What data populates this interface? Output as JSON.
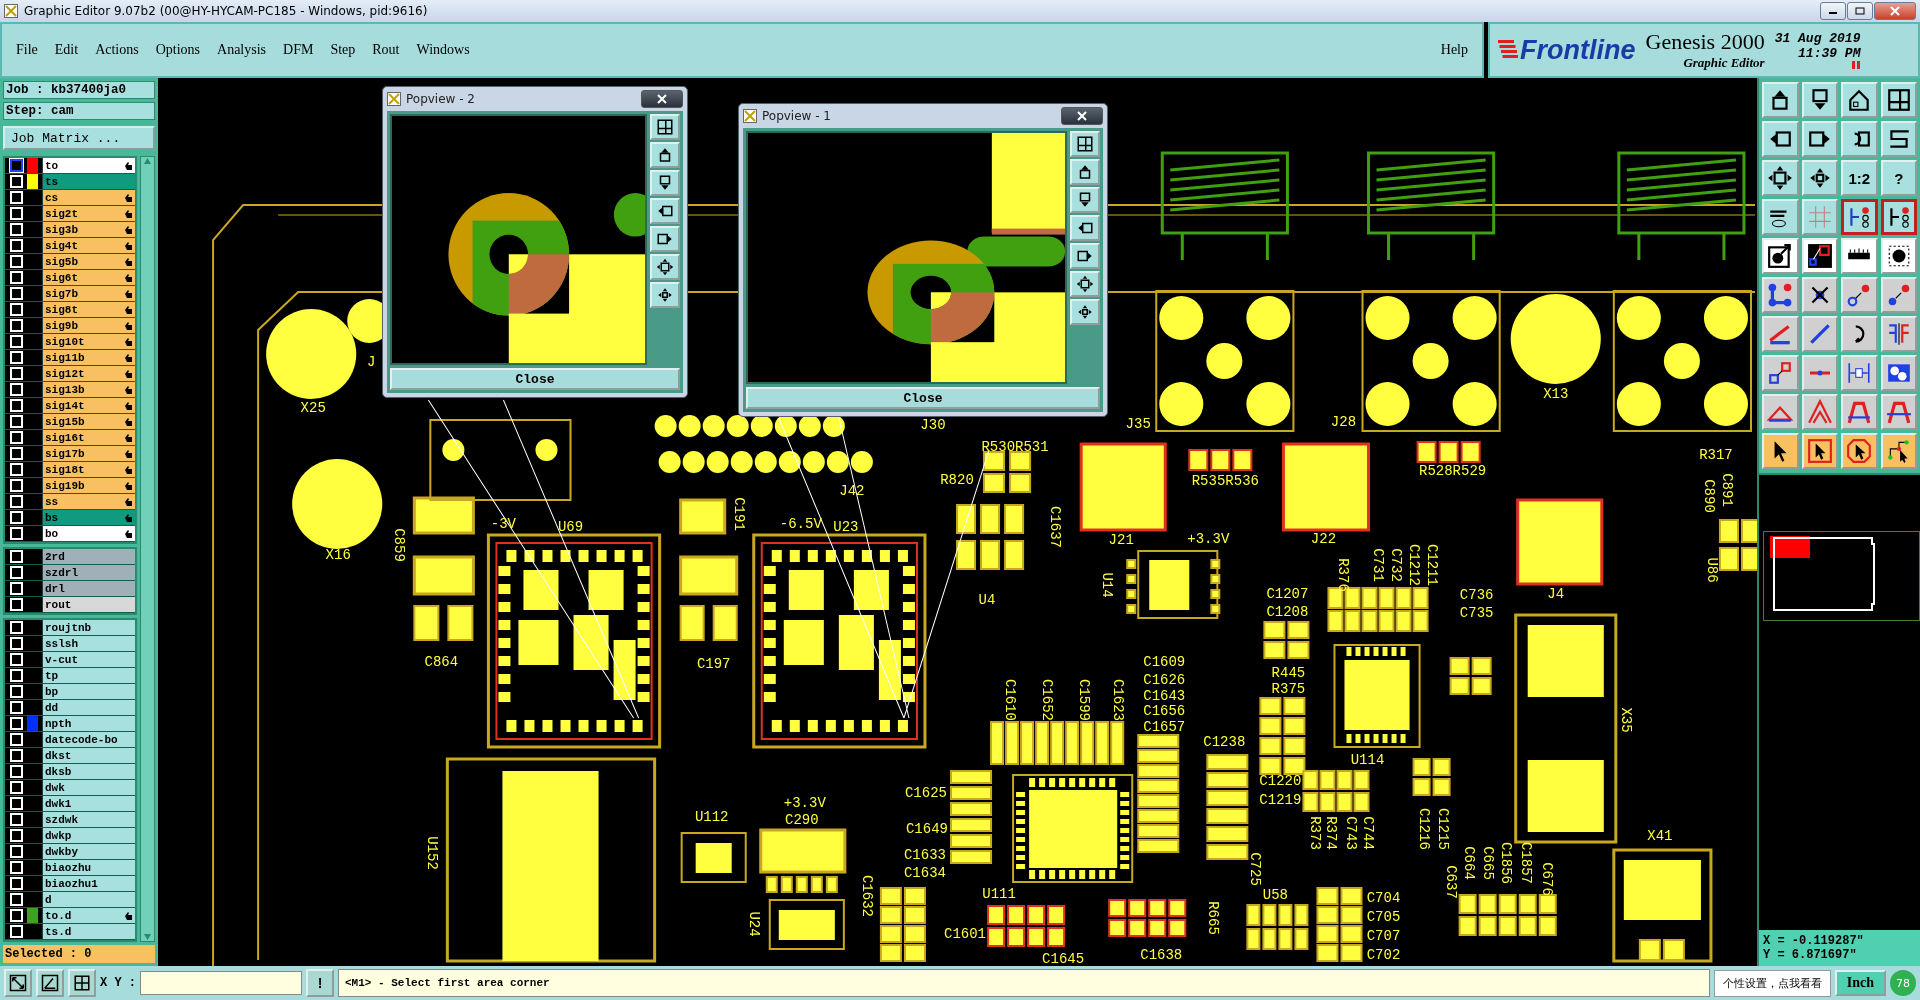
{
  "window": {
    "title": "Graphic Editor 9.07b2 (00@HY-HYCAM-PC185 - Windows, pid:9616)"
  },
  "menu": [
    "File",
    "Edit",
    "Actions",
    "Options",
    "Analysis",
    "DFM",
    "Step",
    "Rout",
    "Windows"
  ],
  "help": "Help",
  "brand": {
    "logo": "Frontline",
    "product": "Genesis 2000",
    "subtitle": "Graphic Editor",
    "date": "31 Aug 2019",
    "time": "11:39 PM"
  },
  "job": {
    "job": "Job : kb37400ja0",
    "step": "Step: cam",
    "matrix_button": "Job Matrix ..."
  },
  "layer_groups": [
    {
      "layers": [
        {
          "name": "to",
          "kind": "silk",
          "color": "#ff0000",
          "work": true,
          "board": true
        },
        {
          "name": "ts",
          "kind": "mask",
          "color": "#ffff00",
          "work": false,
          "board": false
        },
        {
          "name": "cs",
          "kind": "signal",
          "work": false,
          "board": true
        },
        {
          "name": "sig2t",
          "kind": "signal",
          "work": false,
          "board": true
        },
        {
          "name": "sig3b",
          "kind": "signal",
          "work": false,
          "board": true
        },
        {
          "name": "sig4t",
          "kind": "signal",
          "work": false,
          "board": true
        },
        {
          "name": "sig5b",
          "kind": "signal",
          "work": false,
          "board": true
        },
        {
          "name": "sig6t",
          "kind": "signal",
          "work": false,
          "board": true
        },
        {
          "name": "sig7b",
          "kind": "signal",
          "work": false,
          "board": true
        },
        {
          "name": "sig8t",
          "kind": "signal",
          "work": false,
          "board": true
        },
        {
          "name": "sig9b",
          "kind": "signal",
          "work": false,
          "board": true
        },
        {
          "name": "sig10t",
          "kind": "signal",
          "work": false,
          "board": true
        },
        {
          "name": "sig11b",
          "kind": "signal",
          "work": false,
          "board": true
        },
        {
          "name": "sig12t",
          "kind": "signal",
          "work": false,
          "board": true
        },
        {
          "name": "sig13b",
          "kind": "signal",
          "work": false,
          "board": true
        },
        {
          "name": "sig14t",
          "kind": "signal",
          "work": false,
          "board": true
        },
        {
          "name": "sig15b",
          "kind": "signal",
          "work": false,
          "board": true
        },
        {
          "name": "sig16t",
          "kind": "signal",
          "work": false,
          "board": true
        },
        {
          "name": "sig17b",
          "kind": "signal",
          "work": false,
          "board": true
        },
        {
          "name": "sig18t",
          "kind": "signal",
          "work": false,
          "board": true
        },
        {
          "name": "sig19b",
          "kind": "signal",
          "work": false,
          "board": true
        },
        {
          "name": "ss",
          "kind": "signal",
          "work": false,
          "board": true
        },
        {
          "name": "bs",
          "kind": "mask",
          "work": false,
          "board": true
        },
        {
          "name": "bo",
          "kind": "silk",
          "work": false,
          "board": true
        }
      ]
    },
    {
      "layers": [
        {
          "name": "2rd",
          "kind": "drill",
          "work": false,
          "board": false
        },
        {
          "name": "szdrl",
          "kind": "drill",
          "work": false,
          "board": false
        },
        {
          "name": "drl",
          "kind": "drill",
          "work": false,
          "board": false
        },
        {
          "name": "rout",
          "kind": "rout",
          "work": false,
          "board": false
        }
      ]
    },
    {
      "layers": [
        {
          "name": "roujtnb",
          "kind": "doc",
          "work": false,
          "board": false
        },
        {
          "name": "sslsh",
          "kind": "doc",
          "work": false,
          "board": false
        },
        {
          "name": "v-cut",
          "kind": "doc",
          "work": false,
          "board": false
        },
        {
          "name": "tp",
          "kind": "doc",
          "work": false,
          "board": false
        },
        {
          "name": "bp",
          "kind": "doc",
          "work": false,
          "board": false
        },
        {
          "name": "dd",
          "kind": "doc",
          "work": false,
          "board": false
        },
        {
          "name": "npth",
          "kind": "doc",
          "color": "#0030ff",
          "work": false,
          "board": false
        },
        {
          "name": "datecode-bo",
          "kind": "doc",
          "work": false,
          "board": false
        },
        {
          "name": "dkst",
          "kind": "doc",
          "work": false,
          "board": false
        },
        {
          "name": "dksb",
          "kind": "doc",
          "work": false,
          "board": false
        },
        {
          "name": "dwk",
          "kind": "doc",
          "work": false,
          "board": false
        },
        {
          "name": "dwk1",
          "kind": "doc",
          "work": false,
          "board": false
        },
        {
          "name": "szdwk",
          "kind": "doc",
          "work": false,
          "board": false
        },
        {
          "name": "dwkp",
          "kind": "doc",
          "work": false,
          "board": false
        },
        {
          "name": "dwkby",
          "kind": "doc",
          "work": false,
          "board": false
        },
        {
          "name": "biaozhu",
          "kind": "doc",
          "work": false,
          "board": false
        },
        {
          "name": "biaozhu1",
          "kind": "doc",
          "work": false,
          "board": false
        },
        {
          "name": "d",
          "kind": "doc",
          "work": false,
          "board": false
        },
        {
          "name": "to.d",
          "kind": "doc",
          "color": "#40a020",
          "work": false,
          "board": true
        },
        {
          "name": "ts.d",
          "kind": "doc",
          "work": false,
          "board": false
        }
      ]
    }
  ],
  "selected": "Selected : 0",
  "toolbar": [
    {
      "kind": "view",
      "on": false
    },
    {
      "kind": "view",
      "on": false
    },
    {
      "kind": "view",
      "on": false
    },
    {
      "kind": "view",
      "on": false
    },
    {
      "kind": "view",
      "on": false
    },
    {
      "kind": "view",
      "on": false
    },
    {
      "kind": "view",
      "on": false
    },
    {
      "kind": "view",
      "on": false
    },
    {
      "kind": "view",
      "on": false
    },
    {
      "kind": "view",
      "on": false
    },
    {
      "kind": "view",
      "on": false,
      "label": "1:2"
    },
    {
      "kind": "view",
      "on": false,
      "label": "?"
    },
    {
      "kind": "view",
      "on": false
    },
    {
      "kind": "view",
      "on": false
    },
    {
      "kind": "view",
      "on": true
    },
    {
      "kind": "view",
      "on": true
    },
    {
      "kind": "measure",
      "on": false
    },
    {
      "kind": "measure",
      "on": false
    },
    {
      "kind": "measure",
      "on": false
    },
    {
      "kind": "measure",
      "on": false
    },
    {
      "kind": "edit",
      "on": false
    },
    {
      "kind": "edit",
      "on": false
    },
    {
      "kind": "edit",
      "on": false
    },
    {
      "kind": "edit",
      "on": false
    },
    {
      "kind": "edit",
      "on": false
    },
    {
      "kind": "edit",
      "on": false
    },
    {
      "kind": "edit",
      "on": false
    },
    {
      "kind": "edit",
      "on": false
    },
    {
      "kind": "edit",
      "on": false
    },
    {
      "kind": "edit",
      "on": false
    },
    {
      "kind": "edit",
      "on": false
    },
    {
      "kind": "edit",
      "on": false
    },
    {
      "kind": "edit",
      "on": false
    },
    {
      "kind": "edit",
      "on": false
    },
    {
      "kind": "edit",
      "on": false
    },
    {
      "kind": "edit",
      "on": false
    },
    {
      "kind": "select",
      "on": false
    },
    {
      "kind": "select",
      "on": false
    },
    {
      "kind": "select",
      "on": false
    },
    {
      "kind": "select",
      "on": false
    }
  ],
  "coordinates": {
    "x": "X = -0.119287\"",
    "y": "Y = 6.871697\""
  },
  "popviews": [
    {
      "title": "Popview - 2",
      "close": "Close"
    },
    {
      "title": "Popview - 1",
      "close": "Close"
    }
  ],
  "canvas_labels": [
    {
      "text": "X25",
      "kind": "horizontal"
    },
    {
      "text": "X16",
      "kind": "horizontal"
    },
    {
      "text": "J",
      "kind": "horizontal"
    },
    {
      "text": "-3V",
      "kind": "horizontal"
    },
    {
      "text": "U69",
      "kind": "horizontal"
    },
    {
      "text": "C864",
      "kind": "horizontal"
    },
    {
      "text": "-6.5V",
      "kind": "horizontal"
    },
    {
      "text": "U23",
      "kind": "horizontal"
    },
    {
      "text": "C197",
      "kind": "horizontal"
    },
    {
      "text": "J42",
      "kind": "horizontal"
    },
    {
      "text": "J30",
      "kind": "horizontal"
    },
    {
      "text": "R530R531",
      "kind": "horizontal"
    },
    {
      "text": "R820",
      "kind": "horizontal"
    },
    {
      "text": "U4",
      "kind": "horizontal"
    },
    {
      "text": "J35",
      "kind": "horizontal"
    },
    {
      "text": "J28",
      "kind": "horizontal"
    },
    {
      "text": "X13",
      "kind": "horizontal"
    },
    {
      "text": "R535R536",
      "kind": "horizontal"
    },
    {
      "text": "R528R529",
      "kind": "horizontal"
    },
    {
      "text": "R317",
      "kind": "horizontal"
    },
    {
      "text": "J21",
      "kind": "horizontal"
    },
    {
      "text": "+3.3V",
      "kind": "horizontal"
    },
    {
      "text": "J22",
      "kind": "horizontal"
    },
    {
      "text": "C1207",
      "kind": "horizontal"
    },
    {
      "text": "C1208",
      "kind": "horizontal"
    },
    {
      "text": "C736",
      "kind": "horizontal"
    },
    {
      "text": "C735",
      "kind": "horizontal"
    },
    {
      "text": "J4",
      "kind": "horizontal"
    },
    {
      "text": "R445",
      "kind": "horizontal"
    },
    {
      "text": "R375",
      "kind": "horizontal"
    },
    {
      "text": "U114",
      "kind": "horizontal"
    },
    {
      "text": "C1609",
      "kind": "horizontal"
    },
    {
      "text": "C1626",
      "kind": "horizontal"
    },
    {
      "text": "C1643",
      "kind": "horizontal"
    },
    {
      "text": "C1656",
      "kind": "horizontal"
    },
    {
      "text": "C1657",
      "kind": "horizontal"
    },
    {
      "text": "C1238",
      "kind": "horizontal"
    },
    {
      "text": "C1220",
      "kind": "horizontal"
    },
    {
      "text": "C1219",
      "kind": "horizontal"
    },
    {
      "text": "X41",
      "kind": "horizontal"
    },
    {
      "text": "U112",
      "kind": "horizontal"
    },
    {
      "text": "+3.3V",
      "kind": "horizontal"
    },
    {
      "text": "C290",
      "kind": "horizontal"
    },
    {
      "text": "C1625",
      "kind": "horizontal"
    },
    {
      "text": "C1649",
      "kind": "horizontal"
    },
    {
      "text": "C1633",
      "kind": "horizontal"
    },
    {
      "text": "C1634",
      "kind": "horizontal"
    },
    {
      "text": "C1601",
      "kind": "horizontal"
    },
    {
      "text": "C1645",
      "kind": "horizontal"
    },
    {
      "text": "C1638",
      "kind": "horizontal"
    },
    {
      "text": "U58",
      "kind": "horizontal"
    },
    {
      "text": "C704",
      "kind": "horizontal"
    },
    {
      "text": "C705",
      "kind": "horizontal"
    },
    {
      "text": "C707",
      "kind": "horizontal"
    },
    {
      "text": "C702",
      "kind": "horizontal"
    },
    {
      "text": "U111",
      "kind": "horizontal"
    },
    {
      "text": "C859",
      "kind": "vertical"
    },
    {
      "text": "C191",
      "kind": "vertical"
    },
    {
      "text": "C1637",
      "kind": "vertical"
    },
    {
      "text": "U14",
      "kind": "vertical"
    },
    {
      "text": "C891",
      "kind": "vertical"
    },
    {
      "text": "C890",
      "kind": "vertical"
    },
    {
      "text": "U86",
      "kind": "vertical"
    },
    {
      "text": "R376",
      "kind": "vertical"
    },
    {
      "text": "C731",
      "kind": "vertical"
    },
    {
      "text": "C732",
      "kind": "vertical"
    },
    {
      "text": "C1212",
      "kind": "vertical"
    },
    {
      "text": "C1211",
      "kind": "vertical"
    },
    {
      "text": "X35",
      "kind": "vertical"
    },
    {
      "text": "C1610",
      "kind": "vertical"
    },
    {
      "text": "C1652",
      "kind": "vertical"
    },
    {
      "text": "C1599",
      "kind": "vertical"
    },
    {
      "text": "C1623",
      "kind": "vertical"
    },
    {
      "text": "R373",
      "kind": "vertical"
    },
    {
      "text": "R374",
      "kind": "vertical"
    },
    {
      "text": "C743",
      "kind": "vertical"
    },
    {
      "text": "C744",
      "kind": "vertical"
    },
    {
      "text": "C1216",
      "kind": "vertical"
    },
    {
      "text": "C1215",
      "kind": "vertical"
    },
    {
      "text": "C637",
      "kind": "vertical"
    },
    {
      "text": "C664",
      "kind": "vertical"
    },
    {
      "text": "C665",
      "kind": "vertical"
    },
    {
      "text": "C1856",
      "kind": "vertical"
    },
    {
      "text": "C1857",
      "kind": "vertical"
    },
    {
      "text": "C676",
      "kind": "vertical"
    },
    {
      "text": "U152",
      "kind": "vertical"
    },
    {
      "text": "C1632",
      "kind": "vertical"
    },
    {
      "text": "U24",
      "kind": "vertical"
    },
    {
      "text": "C725",
      "kind": "vertical"
    },
    {
      "text": "R665",
      "kind": "vertical"
    }
  ],
  "status_bar": {
    "xy_label": "X Y :",
    "stop_button": "!",
    "message": "<M1> - Select first area corner",
    "tooltip": "个性设置，点我看看",
    "units": "Inch",
    "badge": "78"
  }
}
